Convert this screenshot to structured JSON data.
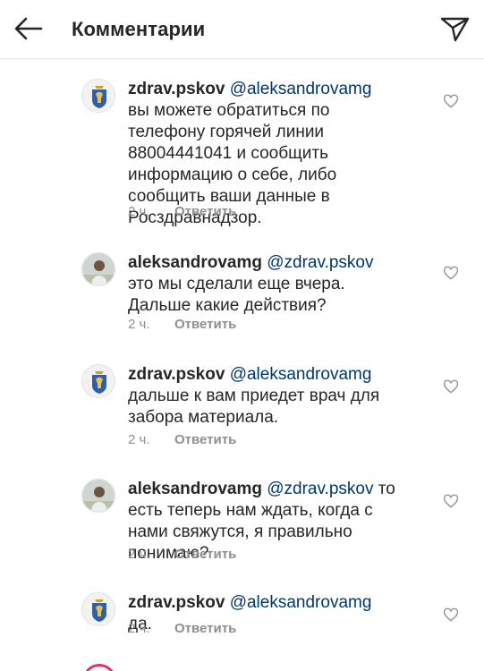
{
  "header": {
    "title": "Комментарии",
    "back_icon": "arrow-left-icon",
    "send_icon": "paper-plane-icon"
  },
  "comments": [
    {
      "username": "zdrav.pskov",
      "mention": "@aleksandrovamg",
      "text": " вы можете обратиться по телефону горячей линии 88004441041 и сообщить информацию о себе, либо сообщить ваши данные  в Росздравнадзор.",
      "time": "2 ч.",
      "reply": "Ответить",
      "avatar_icon": "coat-of-arms-icon"
    },
    {
      "username": "aleksandrovamg",
      "mention": "@zdrav.pskov",
      "text": " это мы сделали еще вчера. Дальше какие действия?",
      "time": "2 ч.",
      "reply": "Ответить",
      "avatar_icon": "user-photo-icon"
    },
    {
      "username": "zdrav.pskov",
      "mention": "@aleksandrovamg",
      "text": " дальше к вам приедет врач для забора материала.",
      "time": "2 ч.",
      "reply": "Ответить",
      "avatar_icon": "coat-of-arms-icon"
    },
    {
      "username": "aleksandrovamg",
      "mention": "@zdrav.pskov",
      "text": " то есть теперь нам ждать, когда с нами свяжутся, я правильно понимаю?",
      "time": "2 ч.",
      "reply": "Ответить",
      "avatar_icon": "user-photo-icon"
    },
    {
      "username": "zdrav.pskov",
      "mention": "@aleksandrovamg",
      "text": " да.",
      "time": "2 ч.",
      "reply": "Ответить",
      "avatar_icon": "coat-of-arms-icon"
    }
  ],
  "colors": {
    "mention": "#00376b",
    "meta": "#8e8e8e",
    "story_ring": "#e1306c"
  }
}
